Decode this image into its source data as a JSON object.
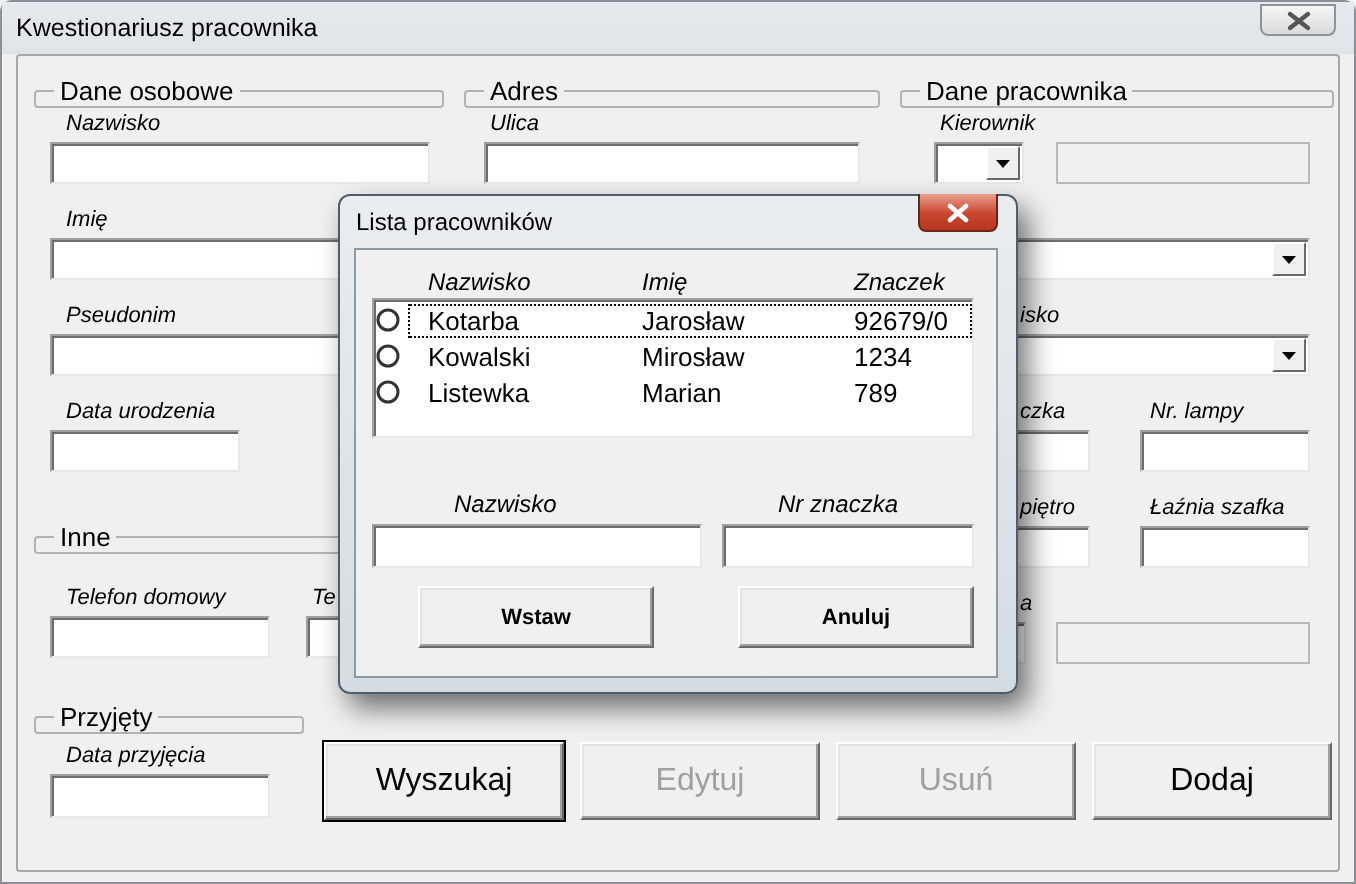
{
  "window": {
    "title": "Kwestionariusz pracownika"
  },
  "dane_osobowe": {
    "title": "Dane osobowe",
    "fields": [
      {
        "label": "Nazwisko"
      },
      {
        "label": "Imię"
      },
      {
        "label": "Pseudonim"
      },
      {
        "label": "Data urodzenia"
      }
    ]
  },
  "adres": {
    "title": "Adres",
    "fields": [
      {
        "label": "Ulica"
      }
    ]
  },
  "dane_pracownika": {
    "title": "Dane pracownika",
    "rows": [
      {
        "fields": [
          {
            "label": "Kierownik",
            "kind": "combo",
            "disabled": false
          },
          {
            "kind": "text",
            "disabled": true
          }
        ]
      },
      {
        "fields": [
          {
            "kind": "combo",
            "disabled": false
          }
        ]
      },
      {
        "fields": [
          {
            "label": "isko",
            "kind": "combo",
            "disabled": false
          }
        ]
      },
      {
        "fields": [
          {
            "label": "czka",
            "kind": "text",
            "disabled": false
          },
          {
            "label": "Nr. lampy",
            "kind": "text",
            "disabled": false
          }
        ]
      },
      {
        "fields": [
          {
            "label": "piętro",
            "kind": "text",
            "disabled": false
          },
          {
            "label": "Łaźnia szafka",
            "kind": "text",
            "disabled": false
          }
        ]
      },
      {
        "fields": [
          {
            "label": "a",
            "kind": "text",
            "disabled": false
          },
          {
            "kind": "text",
            "disabled": true
          }
        ]
      }
    ]
  },
  "inne": {
    "title": "Inne",
    "fields": [
      {
        "label": "Telefon domowy"
      },
      {
        "label": "Te"
      }
    ]
  },
  "przyjety": {
    "title": "Przyjęty",
    "fields": [
      {
        "label": "Data przyjęcia"
      }
    ]
  },
  "buttons": [
    {
      "label": "Wyszukaj",
      "disabled": false,
      "default": true
    },
    {
      "label": "Edytuj",
      "disabled": true,
      "default": false
    },
    {
      "label": "Usuń",
      "disabled": true,
      "default": false
    },
    {
      "label": "Dodaj",
      "disabled": false,
      "default": false
    }
  ],
  "dialog": {
    "title": "Lista pracowników",
    "columns": [
      "Nazwisko",
      "Imię",
      "Znaczek"
    ],
    "rows": [
      {
        "cells": [
          "Kotarba",
          "Jarosław",
          "92679/0"
        ],
        "selected": false,
        "focused": true
      },
      {
        "cells": [
          "Kowalski",
          "Mirosław",
          "1234"
        ],
        "selected": false,
        "focused": false
      },
      {
        "cells": [
          "Listewka",
          "Marian",
          "789"
        ],
        "selected": false,
        "focused": false
      }
    ],
    "fields": [
      {
        "label": "Nazwisko"
      },
      {
        "label": "Nr znaczka"
      }
    ],
    "buttons": [
      "Wstaw",
      "Anuluj"
    ]
  }
}
